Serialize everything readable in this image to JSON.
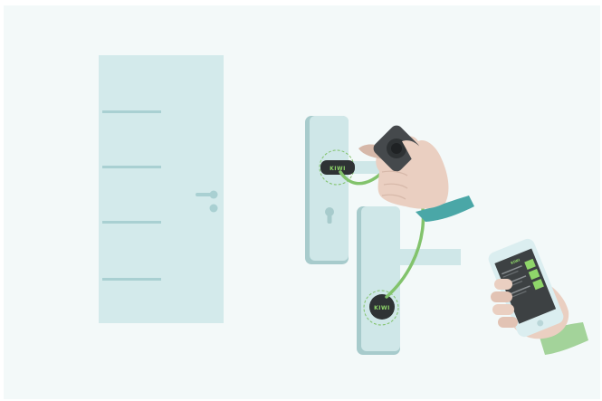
{
  "illustration": {
    "sensor_logo_text": "KIWI",
    "phone_logo_text": "KIWI",
    "colors": {
      "background": "#f3f9f9",
      "door": "#d3eaeb",
      "door_line": "#a9d0d2",
      "lock_plate": "#cfe7e8",
      "lock_plate_shadow": "#a7cbcc",
      "sensor_body": "#2e3234",
      "accent_green": "#82c36c",
      "skin": "#eacfc1",
      "sleeve_teal": "#4aa7a7",
      "sleeve_green": "#a3d39a",
      "phone_screen": "#3d4143",
      "phone_frame": "#dbeef0"
    }
  }
}
